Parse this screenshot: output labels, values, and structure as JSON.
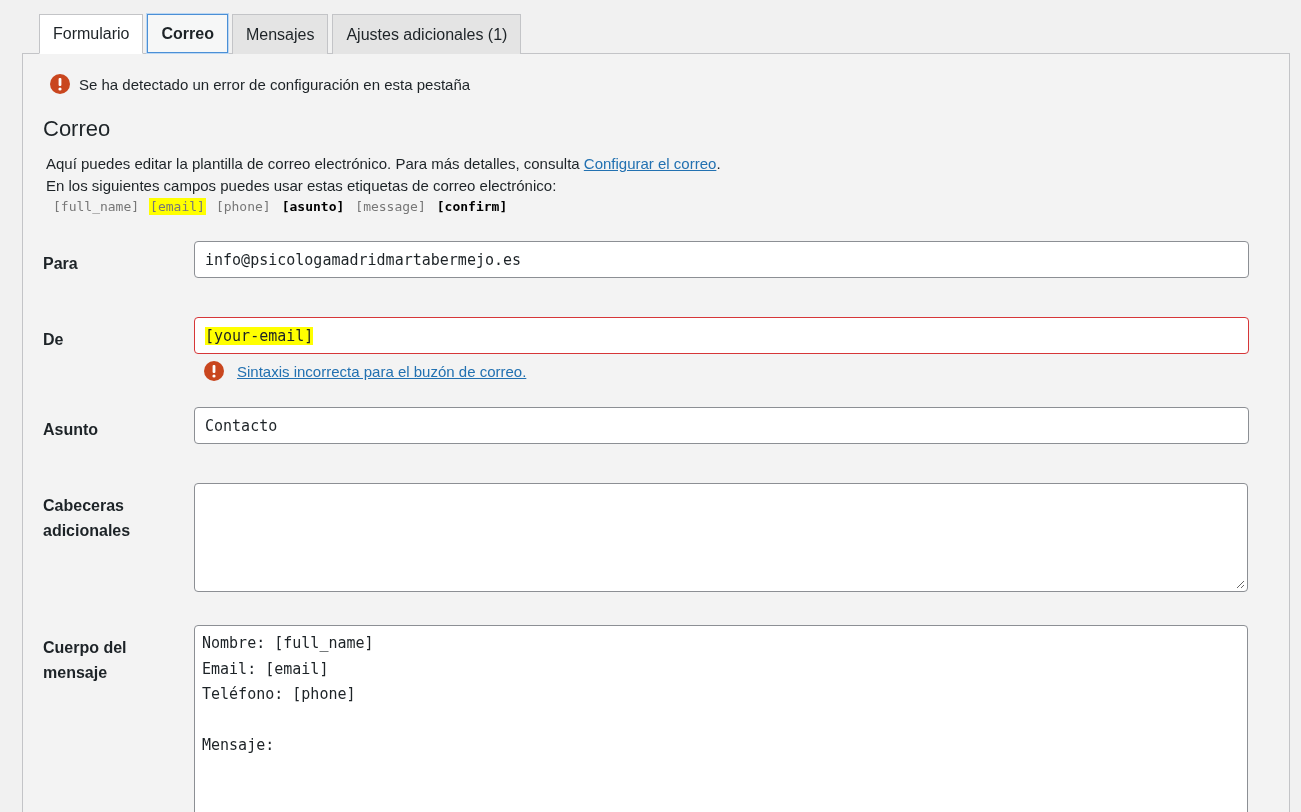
{
  "tabs": [
    {
      "label": "Formulario",
      "selected": false,
      "kind": "light"
    },
    {
      "label": "Correo",
      "selected": true,
      "kind": "plain"
    },
    {
      "label": "Mensajes",
      "selected": false,
      "kind": "plain"
    },
    {
      "label": "Ajustes adicionales (1)",
      "selected": false,
      "kind": "plain"
    }
  ],
  "panel": {
    "error_notice": "Se ha detectado un error de configuración en esta pestaña",
    "title": "Correo",
    "description": {
      "text": "Aquí puedes editar la plantilla de correo electrónico. Para más detalles, consulta ",
      "link": "Configurar el correo",
      "after": "."
    },
    "tags_intro": "En los siguientes campos puedes usar estas etiquetas de correo electrónico:",
    "tags": [
      {
        "label": "[full_name]",
        "kind": "plain"
      },
      {
        "label": "[email]",
        "kind": "highlighted"
      },
      {
        "label": "[phone]",
        "kind": "plain"
      },
      {
        "label": "[asunto]",
        "kind": "bold"
      },
      {
        "label": "[message]",
        "kind": "plain"
      },
      {
        "label": "[confirm]",
        "kind": "bold"
      }
    ],
    "fields": [
      {
        "label": "Para",
        "kind": "input",
        "value": "info@psicologamadridmartabermejo.es",
        "error": false
      },
      {
        "label": "De",
        "kind": "input",
        "value": "[your-email]",
        "error": true,
        "highlighted": true,
        "error_message": "Sintaxis incorrecta para el buzón de correo."
      },
      {
        "label": "Asunto",
        "kind": "input",
        "value": "Contacto",
        "error": false
      },
      {
        "label": "Cabeceras adicionales",
        "kind": "textarea",
        "error": false
      },
      {
        "label": "Cuerpo del mensaje",
        "kind": "body",
        "value": "Nombre: [full_name]\nEmail: [email]\nTeléfono: [phone]\n\nMensaje:",
        "error": false
      }
    ]
  }
}
